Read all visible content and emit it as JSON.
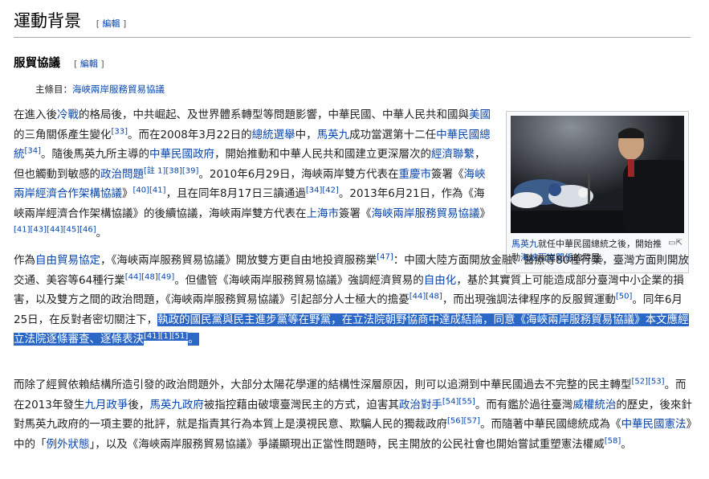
{
  "section": {
    "title": "運動背景",
    "edit_label": "編輯"
  },
  "subsection": {
    "title": "服貿協議",
    "edit_label": "編輯"
  },
  "hatnote": {
    "prefix": "主條目：",
    "link": "海峽兩岸服務貿易協議"
  },
  "p1": [
    {
      "t": "在進入後"
    },
    {
      "t": "冷戰",
      "link": true
    },
    {
      "t": "的格局後，中共崛起、及世界體系轉型等問題影響，中華民國、中華人民共和國與"
    },
    {
      "t": "美國",
      "link": true
    },
    {
      "t": "的三角關係產生變化"
    },
    {
      "t": "[33]",
      "sup": true
    },
    {
      "t": "。而在2008年3月22日的"
    },
    {
      "t": "總統選舉",
      "link": true
    },
    {
      "t": "中，"
    },
    {
      "t": "馬英九",
      "link": true
    },
    {
      "t": "成功當選第十二任"
    },
    {
      "t": "中華民國總統",
      "link": true
    },
    {
      "t": "[34]",
      "sup": true
    },
    {
      "t": "。隨後馬英九所主導的"
    },
    {
      "t": "中華民國政府",
      "link": true
    },
    {
      "t": "，開始推動和中華人民共和國建立更深層次的"
    },
    {
      "t": "經濟聯繫",
      "link": true
    },
    {
      "t": "，但也觸動到敏感的"
    },
    {
      "t": "政治問題",
      "link": true
    },
    {
      "t": "[註 1][38][39]",
      "sup": true
    },
    {
      "t": "。2010年6月29日，海峽兩岸雙方代表在"
    },
    {
      "t": "重慶市",
      "link": true
    },
    {
      "t": "簽署《"
    },
    {
      "t": "海峽兩岸經濟合作架構協議",
      "link": true
    },
    {
      "t": "》"
    },
    {
      "t": "[40][41]",
      "sup": true
    },
    {
      "t": "，且在同年8月17日三讀通過"
    },
    {
      "t": "[34][42]",
      "sup": true
    },
    {
      "t": "。2013年6月21日，作為《海峽兩岸經濟合作架構協議》的後續協議，海峽兩岸雙方代表在"
    },
    {
      "t": "上海市",
      "link": true
    },
    {
      "t": "簽署《"
    },
    {
      "t": "海峽兩岸服務貿易協議",
      "link": true
    },
    {
      "t": "》"
    },
    {
      "t": "[41][43][44][45][46]",
      "sup": true
    },
    {
      "t": "。"
    }
  ],
  "p2": [
    {
      "t": "作為"
    },
    {
      "t": "自由貿易協定",
      "link": true
    },
    {
      "t": "，《海峽兩岸服務貿易協議》開放雙方更自由地投資服務業"
    },
    {
      "t": "[47]",
      "sup": true
    },
    {
      "t": "：中國大陸方面開放金融、醫療等80種行業，臺灣方面則開放交通、美容等64種行業"
    },
    {
      "t": "[44][48][49]",
      "sup": true
    },
    {
      "t": "。但儘管《海峽兩岸服務貿易協議》強調經濟貿易的"
    },
    {
      "t": "自由化",
      "link": true
    },
    {
      "t": "，基於其實質上可能造成部分臺灣中小企業的損害，以及雙方之間的政治問題，《海峽兩岸服務貿易協議》引起部分人士極大的擔憂"
    },
    {
      "t": "[44][48]",
      "sup": true
    },
    {
      "t": "，而出現強調法律程序的反服貿運動"
    },
    {
      "t": "[50]",
      "sup": true
    },
    {
      "t": "。同年6月25日，在反對者密切關注下，"
    },
    {
      "t": "執政的國民黨與民主進步黨等在野黨，在立法院朝野協商中達成結論，同意《海峽兩岸服務貿易協議》本文應經立法院逐條審查、逐條表決",
      "hl": true
    },
    {
      "t": "[41][1][51]",
      "sup": true,
      "hl": true
    },
    {
      "t": "。",
      "hl": true
    }
  ],
  "p3": [
    {
      "t": "而除了經貿依賴結構所造引發的政治問題外，大部分太陽花學運的結構性深層原因，則可以追溯到中華民國過去不完整的民主轉型"
    },
    {
      "t": "[52][53]",
      "sup": true
    },
    {
      "t": "。而在2013年發生"
    },
    {
      "t": "九月政爭",
      "link": true
    },
    {
      "t": "後，"
    },
    {
      "t": "馬英九政府",
      "link": true
    },
    {
      "t": "被指控藉由破壞臺灣民主的方式，迫害其"
    },
    {
      "t": "政治對手",
      "link": true
    },
    {
      "t": "[54][55]",
      "sup": true
    },
    {
      "t": "。而有鑑於過往臺灣"
    },
    {
      "t": "威權統治",
      "link": true
    },
    {
      "t": "的歷史，後來針對馬英九政府的一項主要的批評，就是指責其行為本質上是漠視民意、欺騙人民的獨裁政府"
    },
    {
      "t": "[56][57]",
      "sup": true
    },
    {
      "t": "。而隨著中華民國總統成為《"
    },
    {
      "t": "中華民國憲法",
      "link": true
    },
    {
      "t": "》中的「"
    },
    {
      "t": "例外狀態",
      "link": true
    },
    {
      "t": "」，以及《海峽兩岸服務貿易協議》爭議顯現出正當性問題時，民主開放的公民社會也開始嘗試重塑憲法權威"
    },
    {
      "t": "[58]",
      "sup": true
    },
    {
      "t": "。"
    }
  ],
  "figure": {
    "caption": [
      {
        "t": "馬英九",
        "link": true
      },
      {
        "t": "就任中華民國總統之後，開始推動"
      },
      {
        "t": "海峽兩岸關係",
        "link": true
      },
      {
        "t": "的發展。"
      }
    ],
    "magnify_icon": "magnify-clip-icon"
  }
}
